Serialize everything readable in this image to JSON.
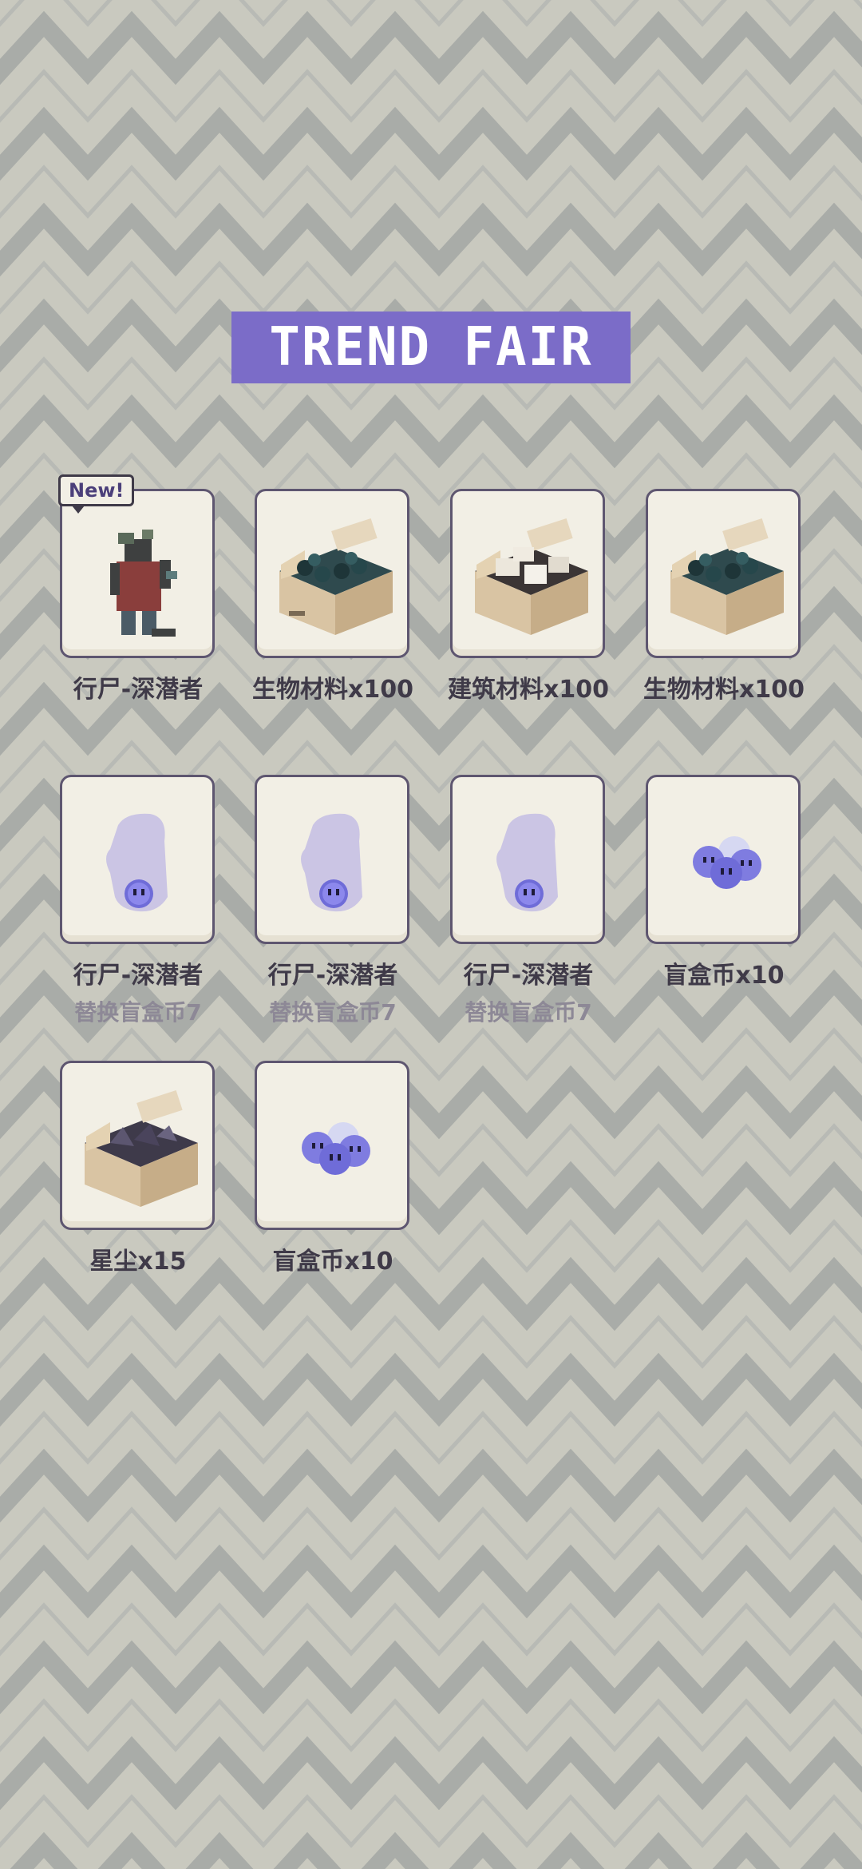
{
  "title": "TREND FAIR",
  "badge_new": "New!",
  "colors": {
    "background": "#c9c9bf",
    "zigzag_dark": "#a9aca8",
    "banner": "#7b6cc8",
    "card_border": "#5e5670",
    "card_fill": "#f2efe5",
    "coin": "#6f6cd8"
  },
  "items": [
    {
      "name": "行尸-深潜者",
      "sub": "",
      "icon": "zombie-diver-character-icon",
      "is_new": true
    },
    {
      "name": "生物材料x100",
      "sub": "",
      "icon": "bio-material-box-icon"
    },
    {
      "name": "建筑材料x100",
      "sub": "",
      "icon": "building-material-box-icon"
    },
    {
      "name": "生物材料x100",
      "sub": "",
      "icon": "bio-material-box-icon"
    },
    {
      "name": "行尸-深潜者",
      "sub": "替换盲盒币7",
      "icon": "ghost-silhouette-icon"
    },
    {
      "name": "行尸-深潜者",
      "sub": "替换盲盒币7",
      "icon": "ghost-silhouette-icon"
    },
    {
      "name": "行尸-深潜者",
      "sub": "替换盲盒币7",
      "icon": "ghost-silhouette-icon"
    },
    {
      "name": "盲盒币x10",
      "sub": "",
      "icon": "blind-box-coins-icon"
    },
    {
      "name": "星尘x15",
      "sub": "",
      "icon": "stardust-box-icon"
    },
    {
      "name": "盲盒币x10",
      "sub": "",
      "icon": "blind-box-coins-icon"
    }
  ]
}
